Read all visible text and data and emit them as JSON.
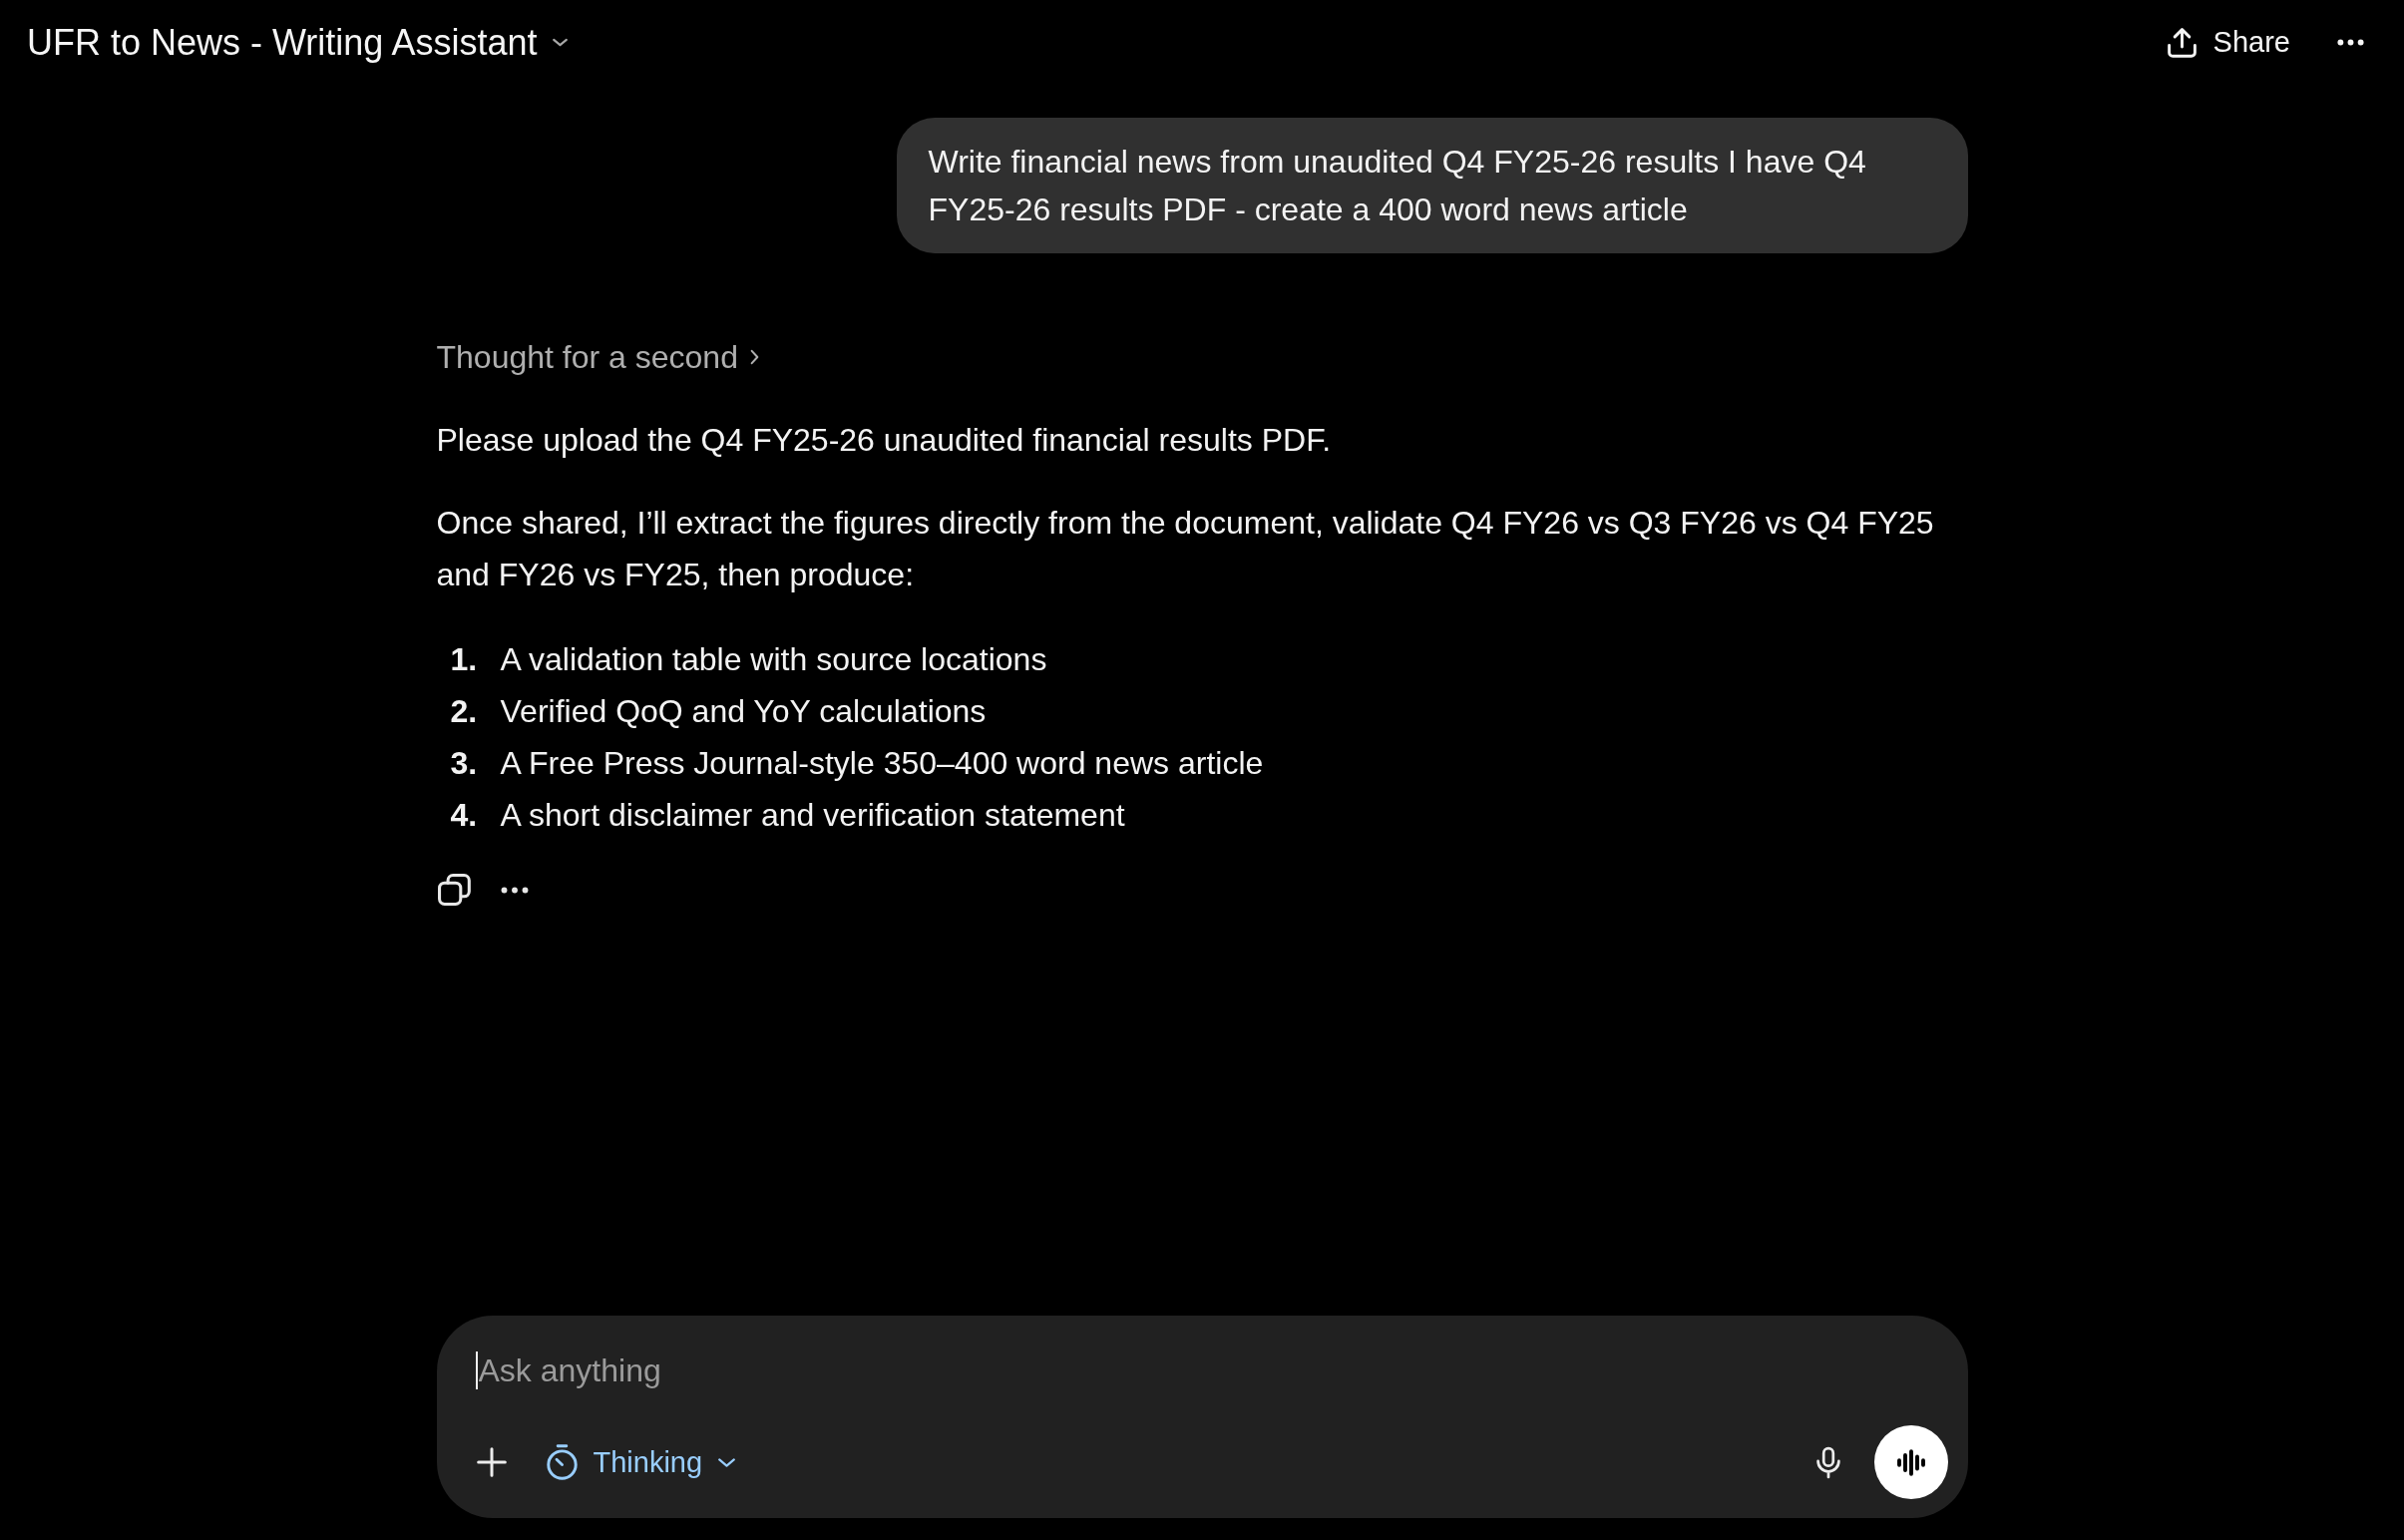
{
  "header": {
    "title": "UFR to News - Writing Assistant",
    "share_label": "Share"
  },
  "user_message": "Write financial news from unaudited Q4 FY25-26 results I have Q4 FY25-26 results PDF - create a 400 word news article",
  "assistant_message": {
    "thought_label": "Thought for a second",
    "expanded": false,
    "paragraphs": [
      "Please upload the Q4 FY25-26 unaudited financial results PDF.",
      "Once shared, I’ll extract the figures directly from the document, validate Q4 FY26 vs Q3 FY26 vs Q4 FY25 and FY26 vs FY25, then produce:"
    ],
    "list": [
      {
        "number": "1.",
        "text": "A validation table with source locations"
      },
      {
        "number": "2.",
        "text": "Verified QoQ and YoY calculations"
      },
      {
        "number": "3.",
        "text": "A Free Press Journal-style 350–400 word news article"
      },
      {
        "number": "4.",
        "text": "A short disclaimer and verification statement"
      }
    ]
  },
  "composer": {
    "placeholder": "Ask anything",
    "focused": true,
    "mode_label": "Thinking"
  }
}
